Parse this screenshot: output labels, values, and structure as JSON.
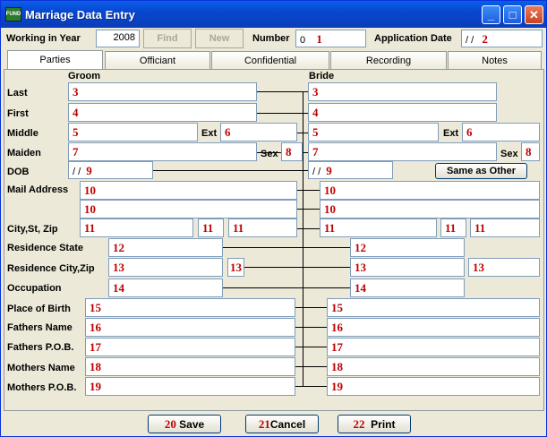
{
  "window": {
    "title": "Marriage Data Entry",
    "icon_text": "FUND",
    "minimize": "_",
    "maximize": "□",
    "close": "✕"
  },
  "toolbar": {
    "year_label": "Working in Year",
    "year_value": "2008",
    "find_label": "Find",
    "new_label": "New",
    "number_label": "Number",
    "number_value": "0",
    "number_marker": "1",
    "app_date_label": "Application Date",
    "app_date_value": "/ /",
    "app_date_marker": "2"
  },
  "tabs": [
    "Parties",
    "Officiant",
    "Confidential",
    "Recording",
    "Notes"
  ],
  "headers": {
    "groom": "Groom",
    "bride": "Bride"
  },
  "labels": {
    "last": "Last",
    "first": "First",
    "middle": "Middle",
    "maiden": "Maiden",
    "dob": "DOB",
    "mail": "Mail Address",
    "city": "City,St, Zip",
    "res_state": "Residence State",
    "res_city": "Residence City,Zip",
    "occupation": "Occupation",
    "pob": "Place of Birth",
    "fathers_name": "Fathers Name",
    "fathers_pob": "Fathers P.O.B.",
    "mothers_name": "Mothers Name",
    "mothers_pob": "Mothers P.O.B.",
    "ext": "Ext",
    "sex": "Sex"
  },
  "markers": {
    "last": "3",
    "first": "4",
    "middle": "5",
    "ext": "6",
    "maiden": "7",
    "sex": "8",
    "dob": "9",
    "mail": "10",
    "city": "11",
    "res_state": "12",
    "res_city": "13",
    "occupation": "14",
    "pob": "15",
    "fathers_name": "16",
    "fathers_pob": "17",
    "mothers_name": "18",
    "mothers_pob": "19"
  },
  "dob_value": "/ /",
  "same_as_other": "Same as Other",
  "buttons": {
    "save_marker": "20",
    "save_label": "Save",
    "cancel_marker": "21",
    "cancel_label": "Cancel",
    "print_marker": "22",
    "print_label": "Print"
  }
}
